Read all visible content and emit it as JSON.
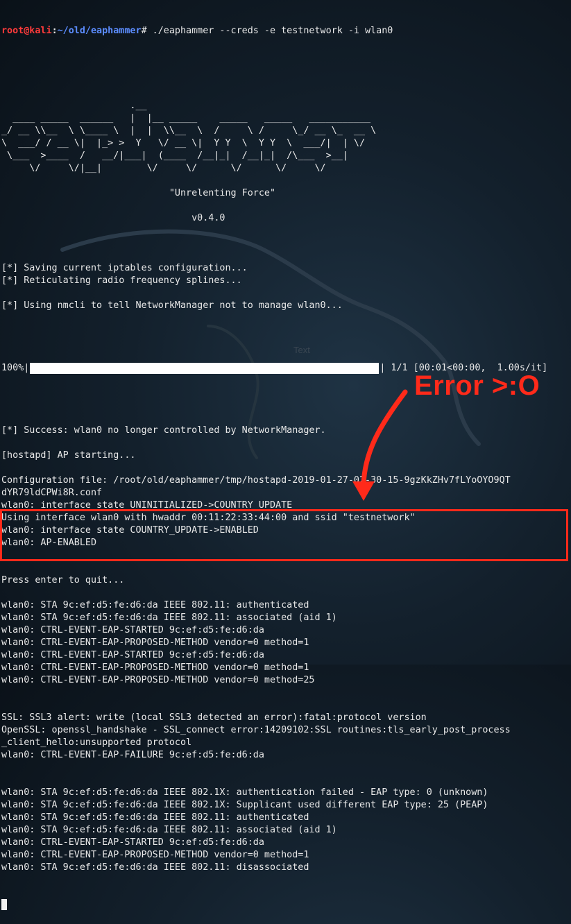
{
  "prompt": {
    "user_host": "root@kali",
    "separator": ":",
    "path": "~/old/eaphammer",
    "command": "# ./eaphammer --creds -e testnetwork -i wlan0"
  },
  "banner": [
    "",
    "",
    "                       .__",
    "  ____ _____  ______   |  |__ _____    _____   _____   ___________",
    "_/ __ \\\\__  \\ \\____ \\  |  |  \\\\__  \\  /     \\ /     \\_/ __ \\_  __ \\",
    "\\  ___/ / __ \\|  |_> >  Y   \\/ __ \\|  Y Y  \\  Y Y  \\  ___/|  | \\/",
    " \\___  >____  /   __/|___|  (____  /__|_|  /__|_|  /\\___  >__|",
    "     \\/     \\/|__|        \\/     \\/      \\/      \\/     \\/",
    "",
    "                              \"Unrelenting Force\"",
    "",
    "                                  v0.4.0",
    ""
  ],
  "log_pre": [
    "[*] Saving current iptables configuration...",
    "[*] Reticulating radio frequency splines...",
    "",
    "[*] Using nmcli to tell NetworkManager not to manage wlan0...",
    ""
  ],
  "progress": {
    "percent_label": "100%|",
    "fraction": 1.0,
    "suffix": "| 1/1 [00:01<00:00,  1.00s/it]"
  },
  "log_post": [
    "",
    "[*] Success: wlan0 no longer controlled by NetworkManager.",
    "",
    "[hostapd] AP starting...",
    "",
    "Configuration file: /root/old/eaphammer/tmp/hostapd-2019-01-27-02-30-15-9gzKkZHv7fLYoOYO9QT",
    "dYR79ldCPWi8R.conf",
    "wlan0: interface state UNINITIALIZED->COUNTRY_UPDATE",
    "Using interface wlan0 with hwaddr 00:11:22:33:44:00 and ssid \"testnetwork\"",
    "wlan0: interface state COUNTRY_UPDATE->ENABLED",
    "wlan0: AP-ENABLED",
    "",
    "",
    "Press enter to quit...",
    "",
    "wlan0: STA 9c:ef:d5:fe:d6:da IEEE 802.11: authenticated",
    "wlan0: STA 9c:ef:d5:fe:d6:da IEEE 802.11: associated (aid 1)",
    "wlan0: CTRL-EVENT-EAP-STARTED 9c:ef:d5:fe:d6:da",
    "wlan0: CTRL-EVENT-EAP-PROPOSED-METHOD vendor=0 method=1",
    "wlan0: CTRL-EVENT-EAP-STARTED 9c:ef:d5:fe:d6:da",
    "wlan0: CTRL-EVENT-EAP-PROPOSED-METHOD vendor=0 method=1",
    "wlan0: CTRL-EVENT-EAP-PROPOSED-METHOD vendor=0 method=25"
  ],
  "log_error": [
    "SSL: SSL3 alert: write (local SSL3 detected an error):fatal:protocol version",
    "OpenSSL: openssl_handshake - SSL_connect error:14209102:SSL routines:tls_early_post_process",
    "_client_hello:unsupported protocol",
    "wlan0: CTRL-EVENT-EAP-FAILURE 9c:ef:d5:fe:d6:da"
  ],
  "log_tail": [
    "wlan0: STA 9c:ef:d5:fe:d6:da IEEE 802.1X: authentication failed - EAP type: 0 (unknown)",
    "wlan0: STA 9c:ef:d5:fe:d6:da IEEE 802.1X: Supplicant used different EAP type: 25 (PEAP)",
    "wlan0: STA 9c:ef:d5:fe:d6:da IEEE 802.11: authenticated",
    "wlan0: STA 9c:ef:d5:fe:d6:da IEEE 802.11: associated (aid 1)",
    "wlan0: CTRL-EVENT-EAP-STARTED 9c:ef:d5:fe:d6:da",
    "wlan0: CTRL-EVENT-EAP-PROPOSED-METHOD vendor=0 method=1",
    "wlan0: STA 9c:ef:d5:fe:d6:da IEEE 802.11: disassociated"
  ],
  "annotation": {
    "label": "Error >:O",
    "color": "#ff2a1a"
  },
  "stray_text": "Text"
}
